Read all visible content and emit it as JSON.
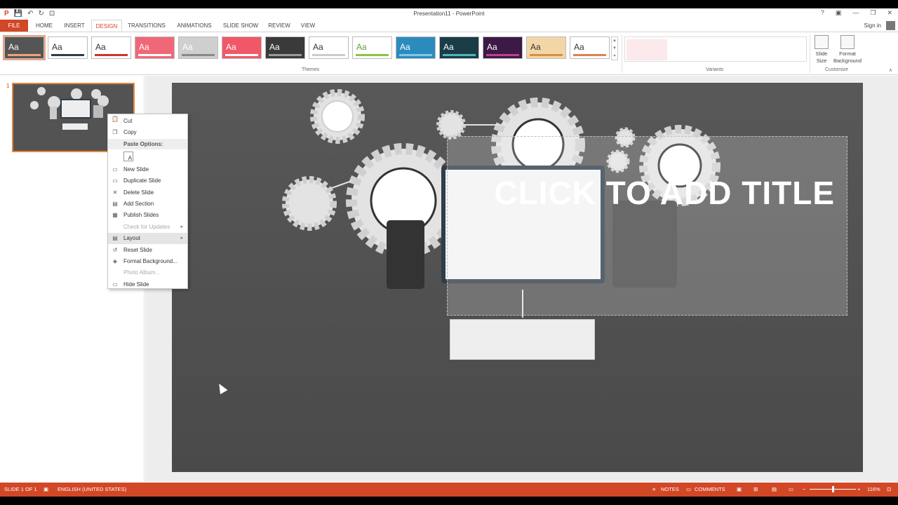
{
  "window": {
    "title": "Presentation11 - PowerPoint",
    "signin": "Sign in",
    "controls": [
      "?",
      "▣",
      "—",
      "❐",
      "✕"
    ]
  },
  "qat_icons": [
    "save-icon",
    "undo-icon",
    "redo-icon",
    "present-icon"
  ],
  "tabs": [
    {
      "label": "FILE"
    },
    {
      "label": "HOME"
    },
    {
      "label": "INSERT"
    },
    {
      "label": "DESIGN"
    },
    {
      "label": "TRANSITIONS"
    },
    {
      "label": "ANIMATIONS"
    },
    {
      "label": "SLIDE SHOW"
    },
    {
      "label": "REVIEW"
    },
    {
      "label": "VIEW"
    }
  ],
  "ribbon": {
    "themes_label": "Themes",
    "variants_label": "Variants",
    "customize_label": "Customize",
    "theme_sample": "Aa",
    "themes": [
      {
        "bg": "#555555",
        "fg": "#ffffff",
        "bar": "#f0a07c"
      },
      {
        "bg": "#ffffff",
        "fg": "#333333",
        "bar": "#2f3d4a"
      },
      {
        "bg": "#ffffff",
        "fg": "#333333",
        "bar": "#cc3333"
      },
      {
        "bg": "#f06878",
        "fg": "#ffffff",
        "bar": "#ffffff"
      },
      {
        "bg": "#cfcfcf",
        "fg": "#ffffff",
        "bar": "#888888"
      },
      {
        "bg": "#f05868",
        "fg": "#ffffff",
        "bar": "#ffffff"
      },
      {
        "bg": "#3a3a3a",
        "fg": "#ffffff",
        "bar": "#999999"
      },
      {
        "bg": "#ffffff",
        "fg": "#333333",
        "bar": "#cccccc"
      },
      {
        "bg": "#ffffff",
        "fg": "#5aa03a",
        "bar": "#8cc43c"
      },
      {
        "bg": "#2c8bbd",
        "fg": "#ffffff",
        "bar": "#7ec8e8"
      },
      {
        "bg": "#1a3c46",
        "fg": "#ffffff",
        "bar": "#4ab8b8"
      },
      {
        "bg": "#3c1a46",
        "fg": "#ffffff",
        "bar": "#c04088"
      },
      {
        "bg": "#f3d6a8",
        "fg": "#333333",
        "bar": "#d69040"
      },
      {
        "bg": "#ffffff",
        "fg": "#333333",
        "bar": "#e08050"
      }
    ],
    "slide_size_label": "Slide\nSize",
    "format_background_label": "Format\nBackground"
  },
  "thumbnail": {
    "number": "1"
  },
  "slide": {
    "title": "CLICK TO ADD TITLE"
  },
  "context_menu": {
    "items": [
      {
        "label": "Cut",
        "icon": "scissors-icon",
        "glyph": "✂",
        "disabled": false
      },
      {
        "label": "Copy",
        "icon": "copy-icon",
        "glyph": "❐",
        "disabled": false
      },
      {
        "label": "Paste Options:",
        "header": true,
        "icon": "clipboard-icon"
      },
      {
        "label": "New Slide",
        "icon": "new-slide-icon",
        "glyph": "▭",
        "disabled": false
      },
      {
        "label": "Duplicate Slide",
        "icon": "duplicate-slide-icon",
        "glyph": "▭",
        "disabled": false
      },
      {
        "label": "Delete Slide",
        "icon": "delete-slide-icon",
        "glyph": "✕",
        "disabled": false
      },
      {
        "label": "Add Section",
        "icon": "section-icon",
        "glyph": "▤",
        "disabled": false
      },
      {
        "label": "Publish Slides",
        "icon": "publish-icon",
        "glyph": "▦",
        "disabled": false
      },
      {
        "label": "Check for Updates",
        "icon": "updates-icon",
        "glyph": "",
        "disabled": true,
        "submenu": true
      },
      {
        "label": "Layout",
        "icon": "layout-icon",
        "glyph": "▤",
        "disabled": false,
        "submenu": true,
        "highlight": true
      },
      {
        "label": "Reset Slide",
        "icon": "reset-slide-icon",
        "glyph": "↺",
        "disabled": false
      },
      {
        "label": "Format Background...",
        "icon": "format-background-icon",
        "glyph": "◈",
        "disabled": false
      },
      {
        "label": "Photo Album...",
        "icon": "photo-album-icon",
        "glyph": "",
        "disabled": true
      },
      {
        "label": "Hide Slide",
        "icon": "hide-slide-icon",
        "glyph": "▭",
        "disabled": false
      }
    ],
    "paste_sample": "A"
  },
  "status": {
    "slide_info": "SLIDE 1 OF 1",
    "language": "ENGLISH (UNITED STATES)",
    "notes": "NOTES",
    "comments": "COMMENTS",
    "zoom": "116%",
    "zoom_minus": "−",
    "zoom_plus": "+"
  },
  "colors": {
    "accent": "#d24726",
    "slide_bg": "#525252"
  }
}
